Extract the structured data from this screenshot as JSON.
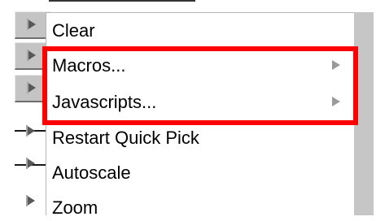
{
  "menu": {
    "items": [
      {
        "label": "Clear",
        "has_submenu": false
      },
      {
        "label": "Macros...",
        "has_submenu": true
      },
      {
        "label": "Javascripts...",
        "has_submenu": true
      },
      {
        "label": "Restart Quick Pick",
        "has_submenu": false
      },
      {
        "label": "Autoscale",
        "has_submenu": false
      },
      {
        "label": "Zoom",
        "has_submenu": false
      }
    ]
  },
  "icons": {
    "toolbar_button": "play-arrow-icon",
    "submenu": "chevron-right-icon"
  },
  "colors": {
    "highlight": "#ff0000",
    "menu_background": "#ffffff",
    "toolbar_raised": "#c4c4c4",
    "scrollbar": "#c6c6c6"
  }
}
